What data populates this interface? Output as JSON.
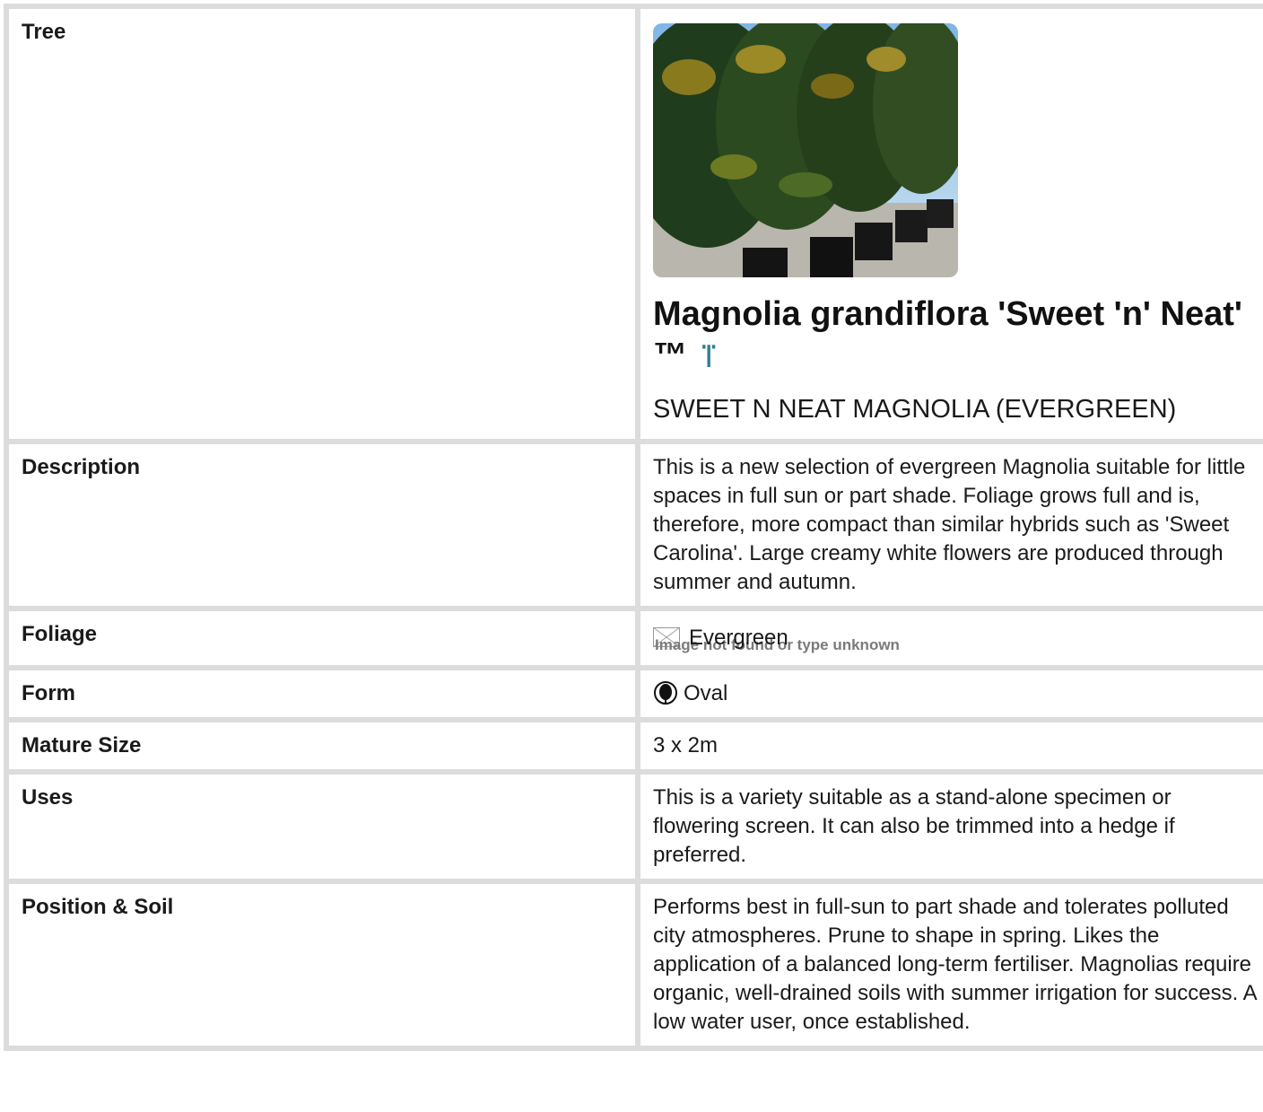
{
  "rows": {
    "tree": {
      "label": "Tree",
      "botanical_name": "Magnolia grandiflora 'Sweet 'n' Neat' ™",
      "leaf_glyph": "ⴶ",
      "common_name": "SWEET N NEAT MAGNOLIA (EVERGREEN)"
    },
    "description": {
      "label": "Description",
      "text": "This is a new selection of evergreen Magnolia suitable for little spaces in full sun or part shade. Foliage grows full and is, therefore, more compact than similar hybrids such as 'Sweet Carolina'. Large creamy white flowers are produced through summer and autumn."
    },
    "foliage": {
      "label": "Foliage",
      "value": "Evergreen",
      "image_alt": "Image not found or type unknown"
    },
    "form": {
      "label": "Form",
      "value": "Oval",
      "icon": "oval-tree-icon"
    },
    "mature_size": {
      "label": "Mature Size",
      "value": "3 x 2m"
    },
    "uses": {
      "label": "Uses",
      "text": "This is a variety suitable as a stand-alone specimen or flowering screen. It can also be trimmed into a hedge if preferred."
    },
    "position_soil": {
      "label": "Position & Soil",
      "text": "Performs best in full-sun to part shade and tolerates polluted city atmospheres. Prune to shape in spring. Likes the application of a balanced long-term fertiliser. Magnolias require organic, well-drained soils with summer irrigation for success. A low water user, once established."
    }
  },
  "colors": {
    "grid": "#dcdcdc",
    "leaf_icon": "#2f7f8f"
  }
}
